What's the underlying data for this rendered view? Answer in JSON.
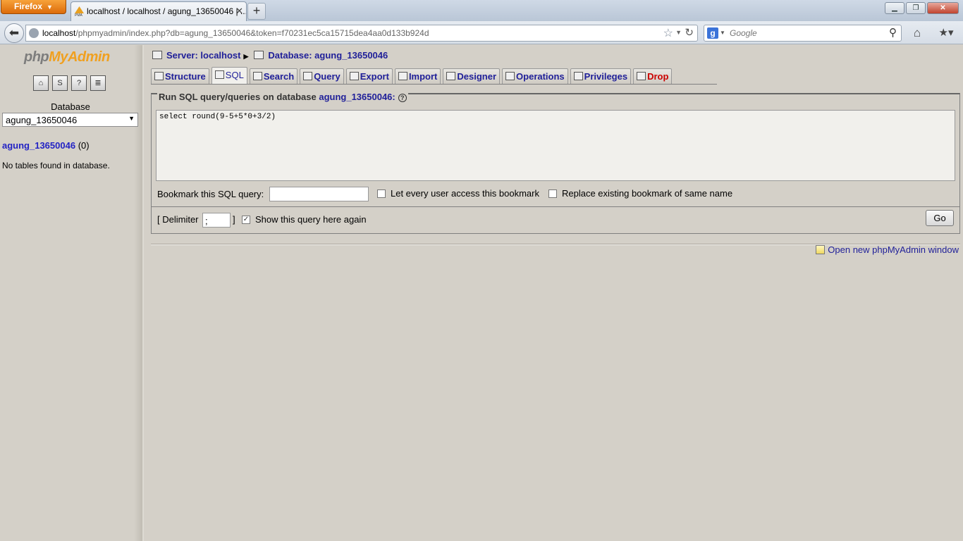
{
  "browser": {
    "app_button": "Firefox",
    "tab_title": "localhost / localhost / agung_13650046 | ...",
    "new_tab": "+",
    "url_host": "localhost",
    "url_rest": "/phpmyadmin/index.php?db=agung_13650046&token=f70231ec5ca15715dea4aa0d133b924d",
    "search_placeholder": "Google",
    "search_engine_icon": "g"
  },
  "sidebar": {
    "logo_php": "php",
    "logo_my": "MyAdmin",
    "icons": [
      "home-icon",
      "sql-icon",
      "query-window-icon",
      "docs-icon"
    ],
    "database_label": "Database",
    "database_selected": "agung_13650046",
    "db_name": "agung_13650046",
    "db_count": "(0)",
    "no_tables": "No tables found in database."
  },
  "main": {
    "server": "Server: localhost",
    "database": "Database: agung_13650046",
    "tabs": [
      {
        "label": "Structure",
        "icon": "structure-icon"
      },
      {
        "label": "SQL",
        "icon": "sql-icon"
      },
      {
        "label": "Search",
        "icon": "search-icon"
      },
      {
        "label": "Query",
        "icon": "query-icon"
      },
      {
        "label": "Export",
        "icon": "export-icon"
      },
      {
        "label": "Import",
        "icon": "import-icon"
      },
      {
        "label": "Designer",
        "icon": "designer-icon"
      },
      {
        "label": "Operations",
        "icon": "operations-icon"
      },
      {
        "label": "Privileges",
        "icon": "privileges-icon"
      },
      {
        "label": "Drop",
        "icon": "drop-icon"
      }
    ],
    "legend_prefix": "Run SQL query/queries on database",
    "legend_db": "agung_13650046:",
    "sql_query": "select round(9-5+5*0+3/2)",
    "bookmark_label": "Bookmark this SQL query:",
    "bookmark_value": "",
    "share_label": "Let every user access this bookmark",
    "replace_label": "Replace existing bookmark of same name",
    "delimiter_label": "[ Delimiter",
    "delimiter_value": ";",
    "delimiter_close": "]",
    "show_again_label": "Show this query here again",
    "show_again_checked": true,
    "go_button": "Go",
    "new_window_link": "Open new phpMyAdmin window"
  }
}
